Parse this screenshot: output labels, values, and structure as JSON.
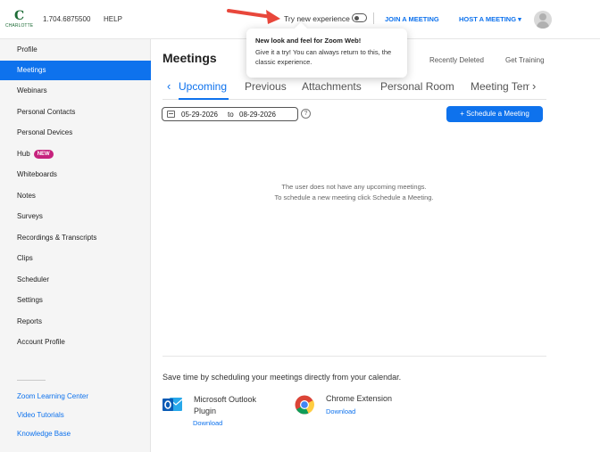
{
  "header": {
    "logo_text": "CHARLOTTE",
    "phone": "1.704.6875500",
    "help": "HELP",
    "try_new": "Try new experience",
    "join_meeting": "JOIN A MEETING",
    "host_meeting": "HOST A MEETING ▾"
  },
  "tooltip": {
    "title": "New look and feel for Zoom Web!",
    "body": "Give it a try! You can always return to this, the classic experience."
  },
  "sidebar": {
    "items": [
      {
        "label": "Profile"
      },
      {
        "label": "Meetings",
        "active": true
      },
      {
        "label": "Webinars"
      },
      {
        "label": "Personal Contacts"
      },
      {
        "label": "Personal Devices"
      },
      {
        "label": "Hub",
        "badge": "NEW"
      },
      {
        "label": "Whiteboards"
      },
      {
        "label": "Notes"
      },
      {
        "label": "Surveys"
      },
      {
        "label": "Recordings & Transcripts"
      },
      {
        "label": "Clips"
      },
      {
        "label": "Scheduler"
      },
      {
        "label": "Settings"
      },
      {
        "label": "Reports"
      },
      {
        "label": "Account Profile"
      }
    ],
    "links": [
      "Zoom Learning Center",
      "Video Tutorials",
      "Knowledge Base"
    ]
  },
  "main": {
    "title": "Meetings",
    "recently_deleted": "Recently Deleted",
    "get_training": "Get Training",
    "tabs": [
      "Upcoming",
      "Previous",
      "Attachments",
      "Personal Room",
      "Meeting Templates"
    ],
    "date_from": "05-29-2026",
    "date_to_word": "to",
    "date_to": "08-29-2026",
    "help_glyph": "?",
    "schedule_button": "+ Schedule a Meeting",
    "empty_line1": "The user does not have any upcoming meetings.",
    "empty_line2": "To schedule a new meeting click Schedule a Meeting.",
    "save_time": "Save time by scheduling your meetings directly from your calendar.",
    "outlook_name": "Microsoft Outlook Plugin",
    "outlook_download": "Download",
    "chrome_name": "Chrome Extension",
    "chrome_download": "Download"
  },
  "colors": {
    "accent": "#0e72ed",
    "badge": "#c6227d",
    "arrow": "#e8473b"
  }
}
